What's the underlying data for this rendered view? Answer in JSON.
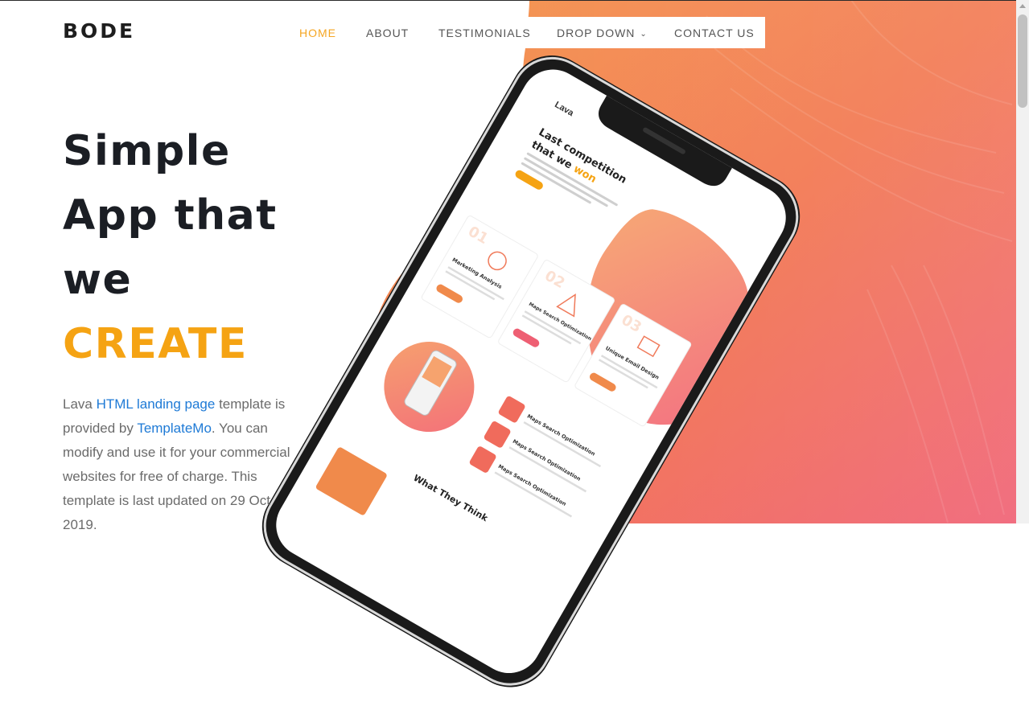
{
  "brand": {
    "logo": "BODE"
  },
  "nav": {
    "items": [
      {
        "label": "HOME",
        "active": true
      },
      {
        "label": "ABOUT",
        "active": false
      },
      {
        "label": "TESTIMONIALS",
        "active": false
      },
      {
        "label": "DROP DOWN",
        "active": false,
        "has_dropdown": true
      },
      {
        "label": "CONTACT US",
        "active": false
      }
    ],
    "dropdown_caret": "⌄"
  },
  "hero": {
    "line1": "Simple",
    "line2": "App that",
    "line3": "we",
    "accent": "CREATE",
    "intro": {
      "t1": "Lava ",
      "link1": "HTML landing page",
      "t2": " template is provided by ",
      "link2": "TemplateMo",
      "t3": ". You can modify and use it for your commercial websites for free of charge. This template is last updated on 29 Oct 2019."
    }
  },
  "phone_screen": {
    "app_name": "Lava",
    "heading_line1": "Last competition",
    "heading_line2_a": "that we ",
    "heading_line2_b": "won",
    "cards": [
      {
        "num": "01",
        "title": "Marketing Analysis"
      },
      {
        "num": "02",
        "title": "Maps Search Optimization"
      },
      {
        "num": "03",
        "title": "Unique Email Design"
      }
    ],
    "features": [
      "Maps Search Optimization",
      "Maps Search Optimization",
      "Maps Search Optimization"
    ],
    "section_title": "What They Think"
  },
  "colors": {
    "accent_orange": "#f5a313",
    "nav_active": "#f5a623",
    "link_blue": "#1e7ad6",
    "hero_gradient_start": "#f28a3e",
    "hero_gradient_end": "#f0607a"
  }
}
